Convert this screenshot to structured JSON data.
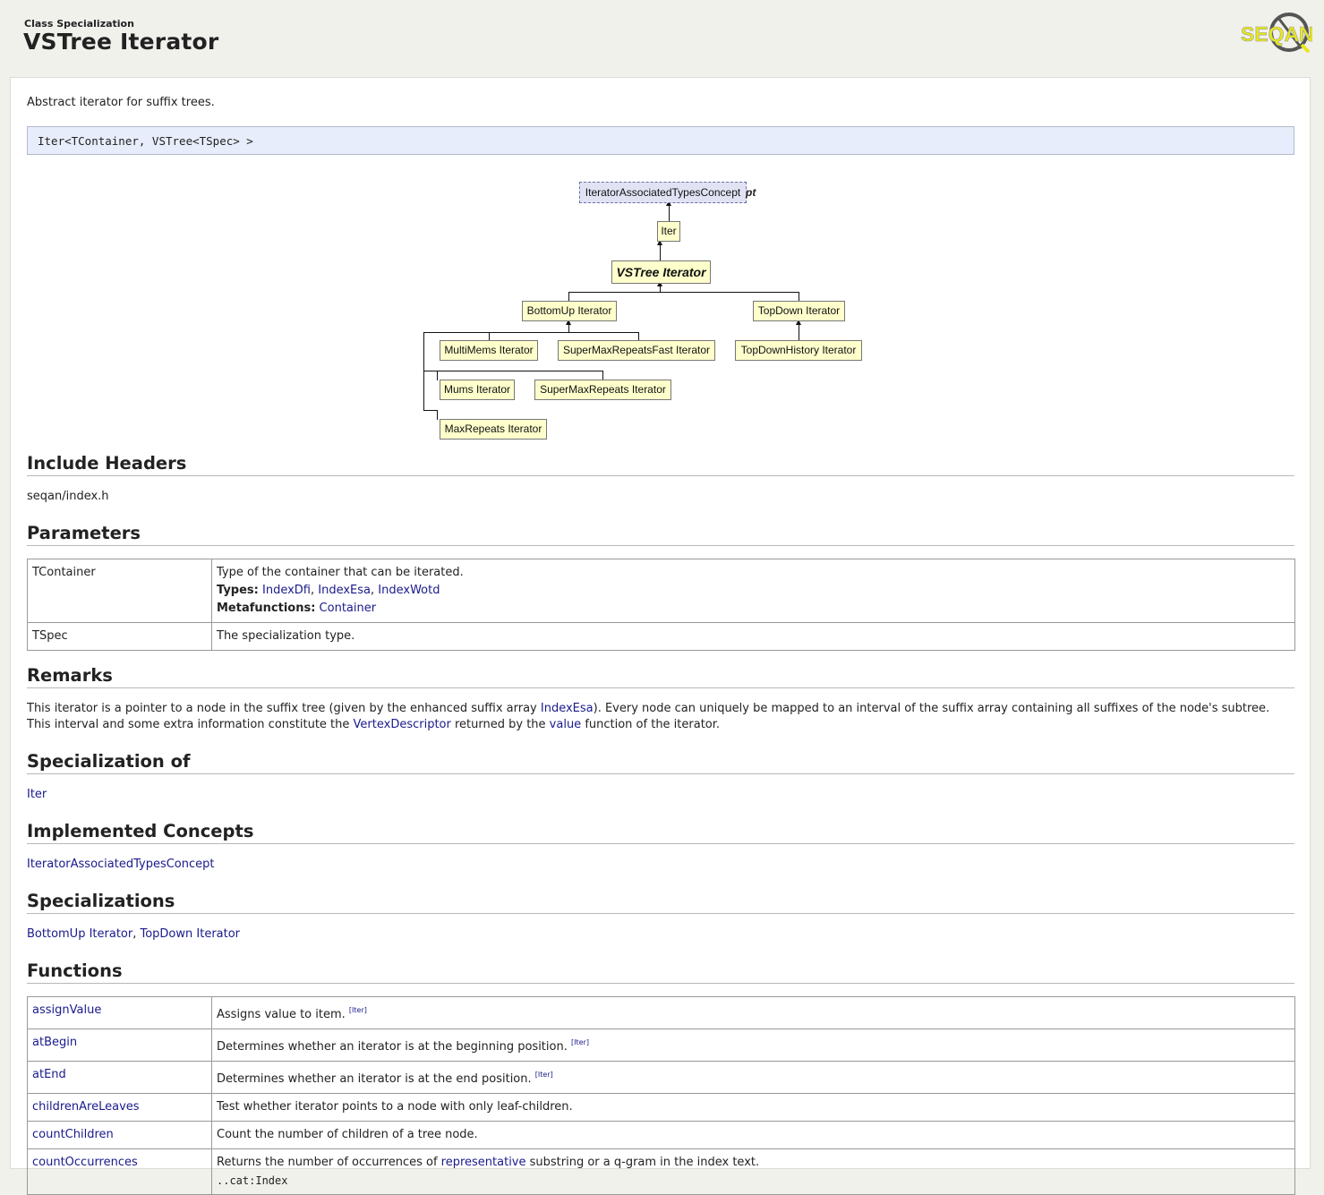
{
  "header": {
    "kind": "Class Specialization",
    "title": "VSTree Iterator",
    "logo_text": "SEQAN"
  },
  "description": "Abstract iterator for suffix trees.",
  "signature": "Iter<TContainer, VSTree<TSpec> >",
  "diagram": {
    "concept_label": "IteratorAssociatedTypesConcept",
    "concept_overflow": "pt",
    "iter_label": "Iter",
    "main_label": "VSTree Iterator",
    "bottomup_label": "BottomUp Iterator",
    "topdown_label": "TopDown Iterator",
    "multimems_label": "MultiMems Iterator",
    "supermaxfast_label": "SuperMaxRepeatsFast Iterator",
    "topdownhistory_label": "TopDownHistory Iterator",
    "mums_label": "Mums Iterator",
    "supermax_label": "SuperMaxRepeats Iterator",
    "maxrepeats_label": "MaxRepeats Iterator"
  },
  "sections": {
    "include_headers": "Include Headers",
    "parameters": "Parameters",
    "remarks": "Remarks",
    "specialization_of": "Specialization of",
    "implemented_concepts": "Implemented Concepts",
    "specializations": "Specializations",
    "functions": "Functions"
  },
  "include_header": "seqan/index.h",
  "parameters": {
    "tcontainer": {
      "name": "TContainer",
      "desc": "Type of the container that can be iterated.",
      "types_label": "Types:",
      "types": [
        "IndexDfi",
        "IndexEsa",
        "IndexWotd"
      ],
      "sep": ", ",
      "meta_label": "Metafunctions:",
      "meta": "Container"
    },
    "tspec": {
      "name": "TSpec",
      "desc": "The specialization type."
    }
  },
  "remarks": {
    "t1": "This iterator is a pointer to a node in the suffix tree (given by the enhanced suffix array ",
    "l1": "IndexEsa",
    "t2": "). Every node can uniquely be mapped to an interval of the suffix array containing all suffixes of the node's subtree. This interval and some extra information constitute the ",
    "l2": "VertexDescriptor",
    "t3": " returned by the ",
    "l3": "value",
    "t4": " function of the iterator."
  },
  "specialization_of": "Iter",
  "implemented_concepts": "IteratorAssociatedTypesConcept",
  "specializations": {
    "a": "BottomUp Iterator",
    "sep": ", ",
    "b": "TopDown Iterator"
  },
  "functions": [
    {
      "name": "assignValue",
      "desc": "Assigns value to item.",
      "ref": "[Iter]"
    },
    {
      "name": "atBegin",
      "desc": "Determines whether an iterator is at the beginning position.",
      "ref": "[Iter]"
    },
    {
      "name": "atEnd",
      "desc": "Determines whether an iterator is at the end position.",
      "ref": "[Iter]"
    },
    {
      "name": "childrenAreLeaves",
      "desc": "Test whether iterator points to a node with only leaf-children.",
      "ref": ""
    },
    {
      "name": "countChildren",
      "desc": "Count the number of children of a tree node.",
      "ref": ""
    },
    {
      "name": "countOccurrences",
      "desc_a": "Returns the number of occurrences of ",
      "desc_link": "representative",
      "desc_b": " substring or a q-gram in the index text.",
      "desc_c": "..cat:Index"
    }
  ],
  "colors": {
    "page_bg": "#f1f1ec",
    "link": "#1a1a8c",
    "node_fill": "#ffffcc",
    "concept_fill": "#e1e3f5",
    "signature_bg": "#e8edfb",
    "logo_yellow": "#e8e81a"
  }
}
